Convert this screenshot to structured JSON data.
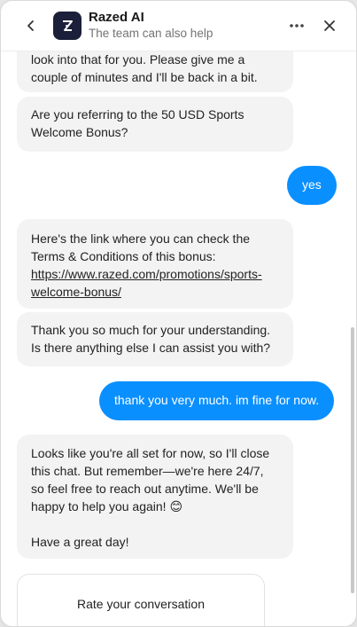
{
  "header": {
    "title": "Razed AI",
    "subtitle": "The team can also help",
    "logo_letter": "Z"
  },
  "messages": [
    {
      "sender": "bot",
      "text": "look into that for you. Please give me a couple of minutes and I'll be back in a bit."
    },
    {
      "sender": "bot",
      "text": "Are you referring to the 50 USD Sports Welcome Bonus?"
    },
    {
      "sender": "user",
      "text": "yes"
    },
    {
      "sender": "bot",
      "text_before_link": "Here's the link where you can check the Terms & Conditions of this bonus:",
      "link": "https://www.razed.com/promotions/sports-welcome-bonus/"
    },
    {
      "sender": "bot",
      "text": "Thank you so much for your understanding. Is there anything else I can assist you with?"
    },
    {
      "sender": "user",
      "text": "thank you very much. im fine for now."
    },
    {
      "sender": "bot",
      "text": "Looks like you're all set for now, so I'll close this chat. But remember—we're here 24/7, so feel free to reach out anytime. We'll be happy to help you again! 😊",
      "text2": "Have a great day!"
    }
  ],
  "rating": {
    "label": "Rate your conversation"
  },
  "colors": {
    "user_bubble": "#0a8fff",
    "bot_bubble": "#f3f3f3",
    "logo_bg": "#1c1f3a"
  },
  "icons": {
    "back": "chevron-left-icon",
    "more": "more-horizontal-icon",
    "close": "close-icon"
  }
}
